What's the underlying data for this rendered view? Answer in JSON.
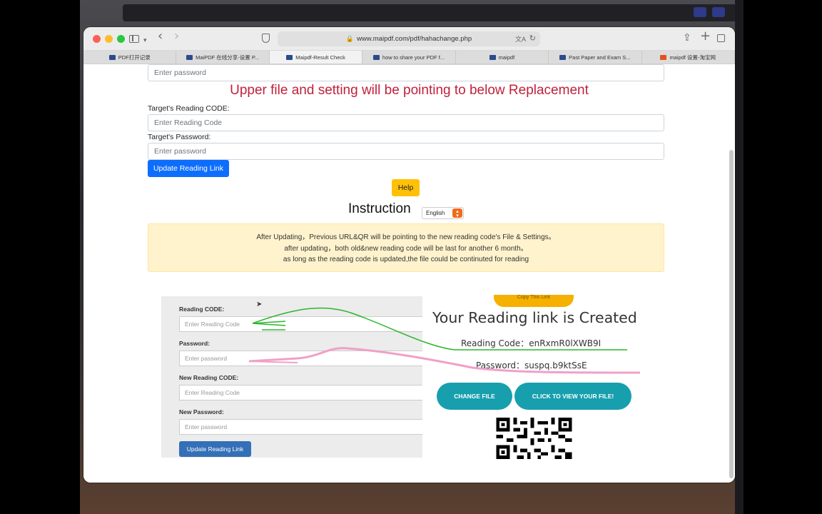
{
  "browser": {
    "url": "www.maipdf.com/pdf/hahachange.php",
    "tabs": [
      {
        "label": "PDF打开记录",
        "active": false
      },
      {
        "label": "MaiPDF 在线分享-设置 P...",
        "active": false
      },
      {
        "label": "Maipdf-Result Check",
        "active": true
      },
      {
        "label": "how to share your PDF f...",
        "active": false
      },
      {
        "label": "maipdf",
        "active": false
      },
      {
        "label": "Past Paper and Exam S...",
        "active": false
      },
      {
        "label": "maipdf 设置-淘宝网",
        "active": false
      }
    ]
  },
  "form": {
    "top_password_placeholder": "Enter password",
    "replacement_heading": "Upper file and setting will be pointing to below Replacement",
    "target_code_label": "Target's Reading CODE:",
    "target_code_placeholder": "Enter Reading Code",
    "target_password_label": "Target's Password:",
    "target_password_placeholder": "Enter password",
    "update_button": "Update Reading Link",
    "help_button": "Help"
  },
  "instruction": {
    "title": "Instruction",
    "language": "English",
    "lines": [
      "After Updating，Previous URL&QR will be pointing to the new reading code's File & Settings。",
      "after updating，both old&new reading code will be last for another 6 month。",
      "as long as the reading code is updated,the file could be continuted for reading"
    ]
  },
  "tutorial": {
    "reading_code_label": "Reading CODE:",
    "reading_code_placeholder": "Enter Reading Code",
    "password_label": "Password:",
    "password_placeholder": "Enter password",
    "new_code_label": "New Reading CODE:",
    "new_code_placeholder": "Enter Reading Code",
    "new_password_label": "New Password:",
    "new_password_placeholder": "Enter password",
    "update_button": "Update Reading Link",
    "copy_button": "Copy This Link",
    "created_title": "Your Reading link is Created",
    "reading_code_text": "Reading Code：enRxmR0lXWB9I",
    "password_text": "Password：suspq.b9ktSsE",
    "change_file_button": "CHANGE FILE",
    "view_file_button": "CLICK TO VIEW YOUR FILE!"
  },
  "colors": {
    "heading_red": "#c0213c",
    "primary_blue": "#0d6efd",
    "help_yellow": "#ffc107",
    "alert_bg": "#fff3cd",
    "teal": "#179fae",
    "arrow_green": "#2bb52b",
    "arrow_pink": "#f0a0c8"
  }
}
